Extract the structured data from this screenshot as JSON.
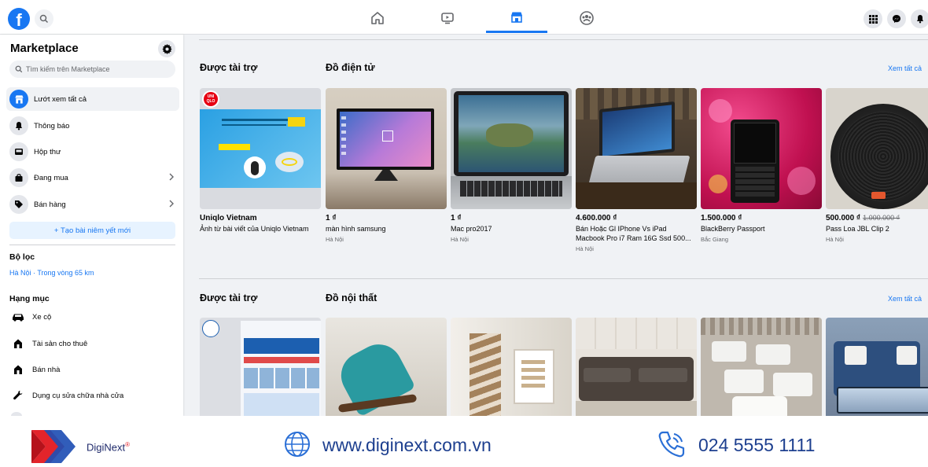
{
  "topbar": {
    "logo_letter": "f",
    "tabs": [
      {
        "name": "home-icon",
        "active": false
      },
      {
        "name": "watch-icon",
        "active": false
      },
      {
        "name": "marketplace-icon",
        "active": true
      },
      {
        "name": "groups-icon",
        "active": false
      }
    ],
    "right_icons": [
      "menu-grid-icon",
      "messenger-icon",
      "notifications-icon"
    ],
    "accent_color": "#1877f2"
  },
  "sidebar": {
    "title": "Marketplace",
    "search_placeholder": "Tìm kiếm trên Marketplace",
    "nav_items": [
      {
        "label": "Lướt xem tất cả",
        "icon": "storefront-icon",
        "active": true
      },
      {
        "label": "Thông báo",
        "icon": "bell-icon",
        "active": false
      },
      {
        "label": "Hộp thư",
        "icon": "inbox-icon",
        "active": false
      },
      {
        "label": "Đang mua",
        "icon": "shopping-bag-icon",
        "active": false
      },
      {
        "label": "Bán hàng",
        "icon": "tag-icon",
        "active": false
      }
    ],
    "create_button": "+ Tạo bài niêm yết mới",
    "filter_heading": "Bộ lọc",
    "location": "Hà Nội · Trong vòng 65 km",
    "category_heading": "Hạng mục",
    "categories": [
      {
        "label": "Xe cộ",
        "icon": "car-icon"
      },
      {
        "label": "Tài sản cho thuê",
        "icon": "rental-house-icon"
      },
      {
        "label": "Bán nhà",
        "icon": "house-sale-icon"
      },
      {
        "label": "Dụng cụ sửa chữa nhà cửa",
        "icon": "wrench-icon"
      }
    ]
  },
  "main": {
    "section1": {
      "sponsored_label": "Được tài trợ",
      "category_label": "Đồ điện tử",
      "see_all": "Xem tất cả",
      "sponsored": {
        "brand_badge": "UNI QLO",
        "name": "Uniqlo Vietnam",
        "desc": "Ảnh từ bài viết của Uniqlo Vietnam"
      },
      "items": [
        {
          "price": "1 ₫",
          "title": "màn hình samsung",
          "loc": "Hà Nội"
        },
        {
          "price": "1 ₫",
          "title": "Mac pro2017",
          "loc": "Hà Nội"
        },
        {
          "price": "4.600.000 ₫",
          "title": "Bán Hoặc Gl IPhone Vs iPad Macbook Pro i7 Ram 16G Ssd 500...",
          "loc": "Hà Nội"
        },
        {
          "price": "1.500.000 ₫",
          "title": "BlackBerry Passport",
          "loc": "Bắc Giang"
        },
        {
          "price": "500.000 ₫",
          "old_price": "1.000.000 ₫",
          "title": "Pass Loa JBL Clip 2",
          "loc": "Hà Nội"
        }
      ]
    },
    "section2": {
      "sponsored_label": "Được tài trợ",
      "category_label": "Đồ nội thất",
      "see_all": "Xem tất cả"
    }
  },
  "footer": {
    "brand": "DigiNext",
    "trademark": "®",
    "website": "www.diginext.com.vn",
    "phone": "024 5555 1111"
  }
}
